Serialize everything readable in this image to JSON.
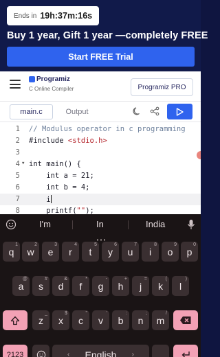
{
  "promo": {
    "timer_label": "Ends in",
    "timer_value": "19h:37m:16s",
    "headline": "Buy 1 year, Gift 1 year —completely FREE",
    "cta": "Start FREE Trial"
  },
  "header": {
    "brand": "Programiz",
    "subtitle": "C Online Compiler",
    "pro_button": "Programiz PRO"
  },
  "tabs": {
    "file": "main.c",
    "output": "Output"
  },
  "editor": {
    "lines": [
      {
        "n": "1",
        "text": "// Modulus operator in c programming"
      },
      {
        "n": "2",
        "text": "#include <stdio.h>"
      },
      {
        "n": "3",
        "text": ""
      },
      {
        "n": "4",
        "text": "int main() {"
      },
      {
        "n": "5",
        "text": "    int a = 21;"
      },
      {
        "n": "6",
        "text": "    int b = 4;"
      },
      {
        "n": "7",
        "text": "    i"
      },
      {
        "n": "8",
        "text": "    printf(\"\");"
      }
    ],
    "active_line": "7"
  },
  "keyboard": {
    "suggestions": [
      "I'm",
      "In",
      "India"
    ],
    "row1": [
      "q",
      "w",
      "e",
      "r",
      "t",
      "y",
      "u",
      "i",
      "o",
      "p"
    ],
    "row1_hints": [
      "1",
      "2",
      "3",
      "4",
      "5",
      "6",
      "7",
      "8",
      "9",
      "0"
    ],
    "row2": [
      "a",
      "s",
      "d",
      "f",
      "g",
      "h",
      "j",
      "k",
      "l"
    ],
    "row2_hints": [
      "@",
      "#",
      "&",
      "*",
      "-",
      "+",
      "=",
      "(",
      ")"
    ],
    "row3": [
      "z",
      "x",
      "c",
      "v",
      "b",
      "n",
      "m"
    ],
    "row3_hints": [
      "_",
      "$",
      "\"",
      "'",
      ":",
      ";",
      "/"
    ],
    "symbols_key": "?123",
    "space_label": "English",
    "accent_color": "#f3a1b5"
  }
}
